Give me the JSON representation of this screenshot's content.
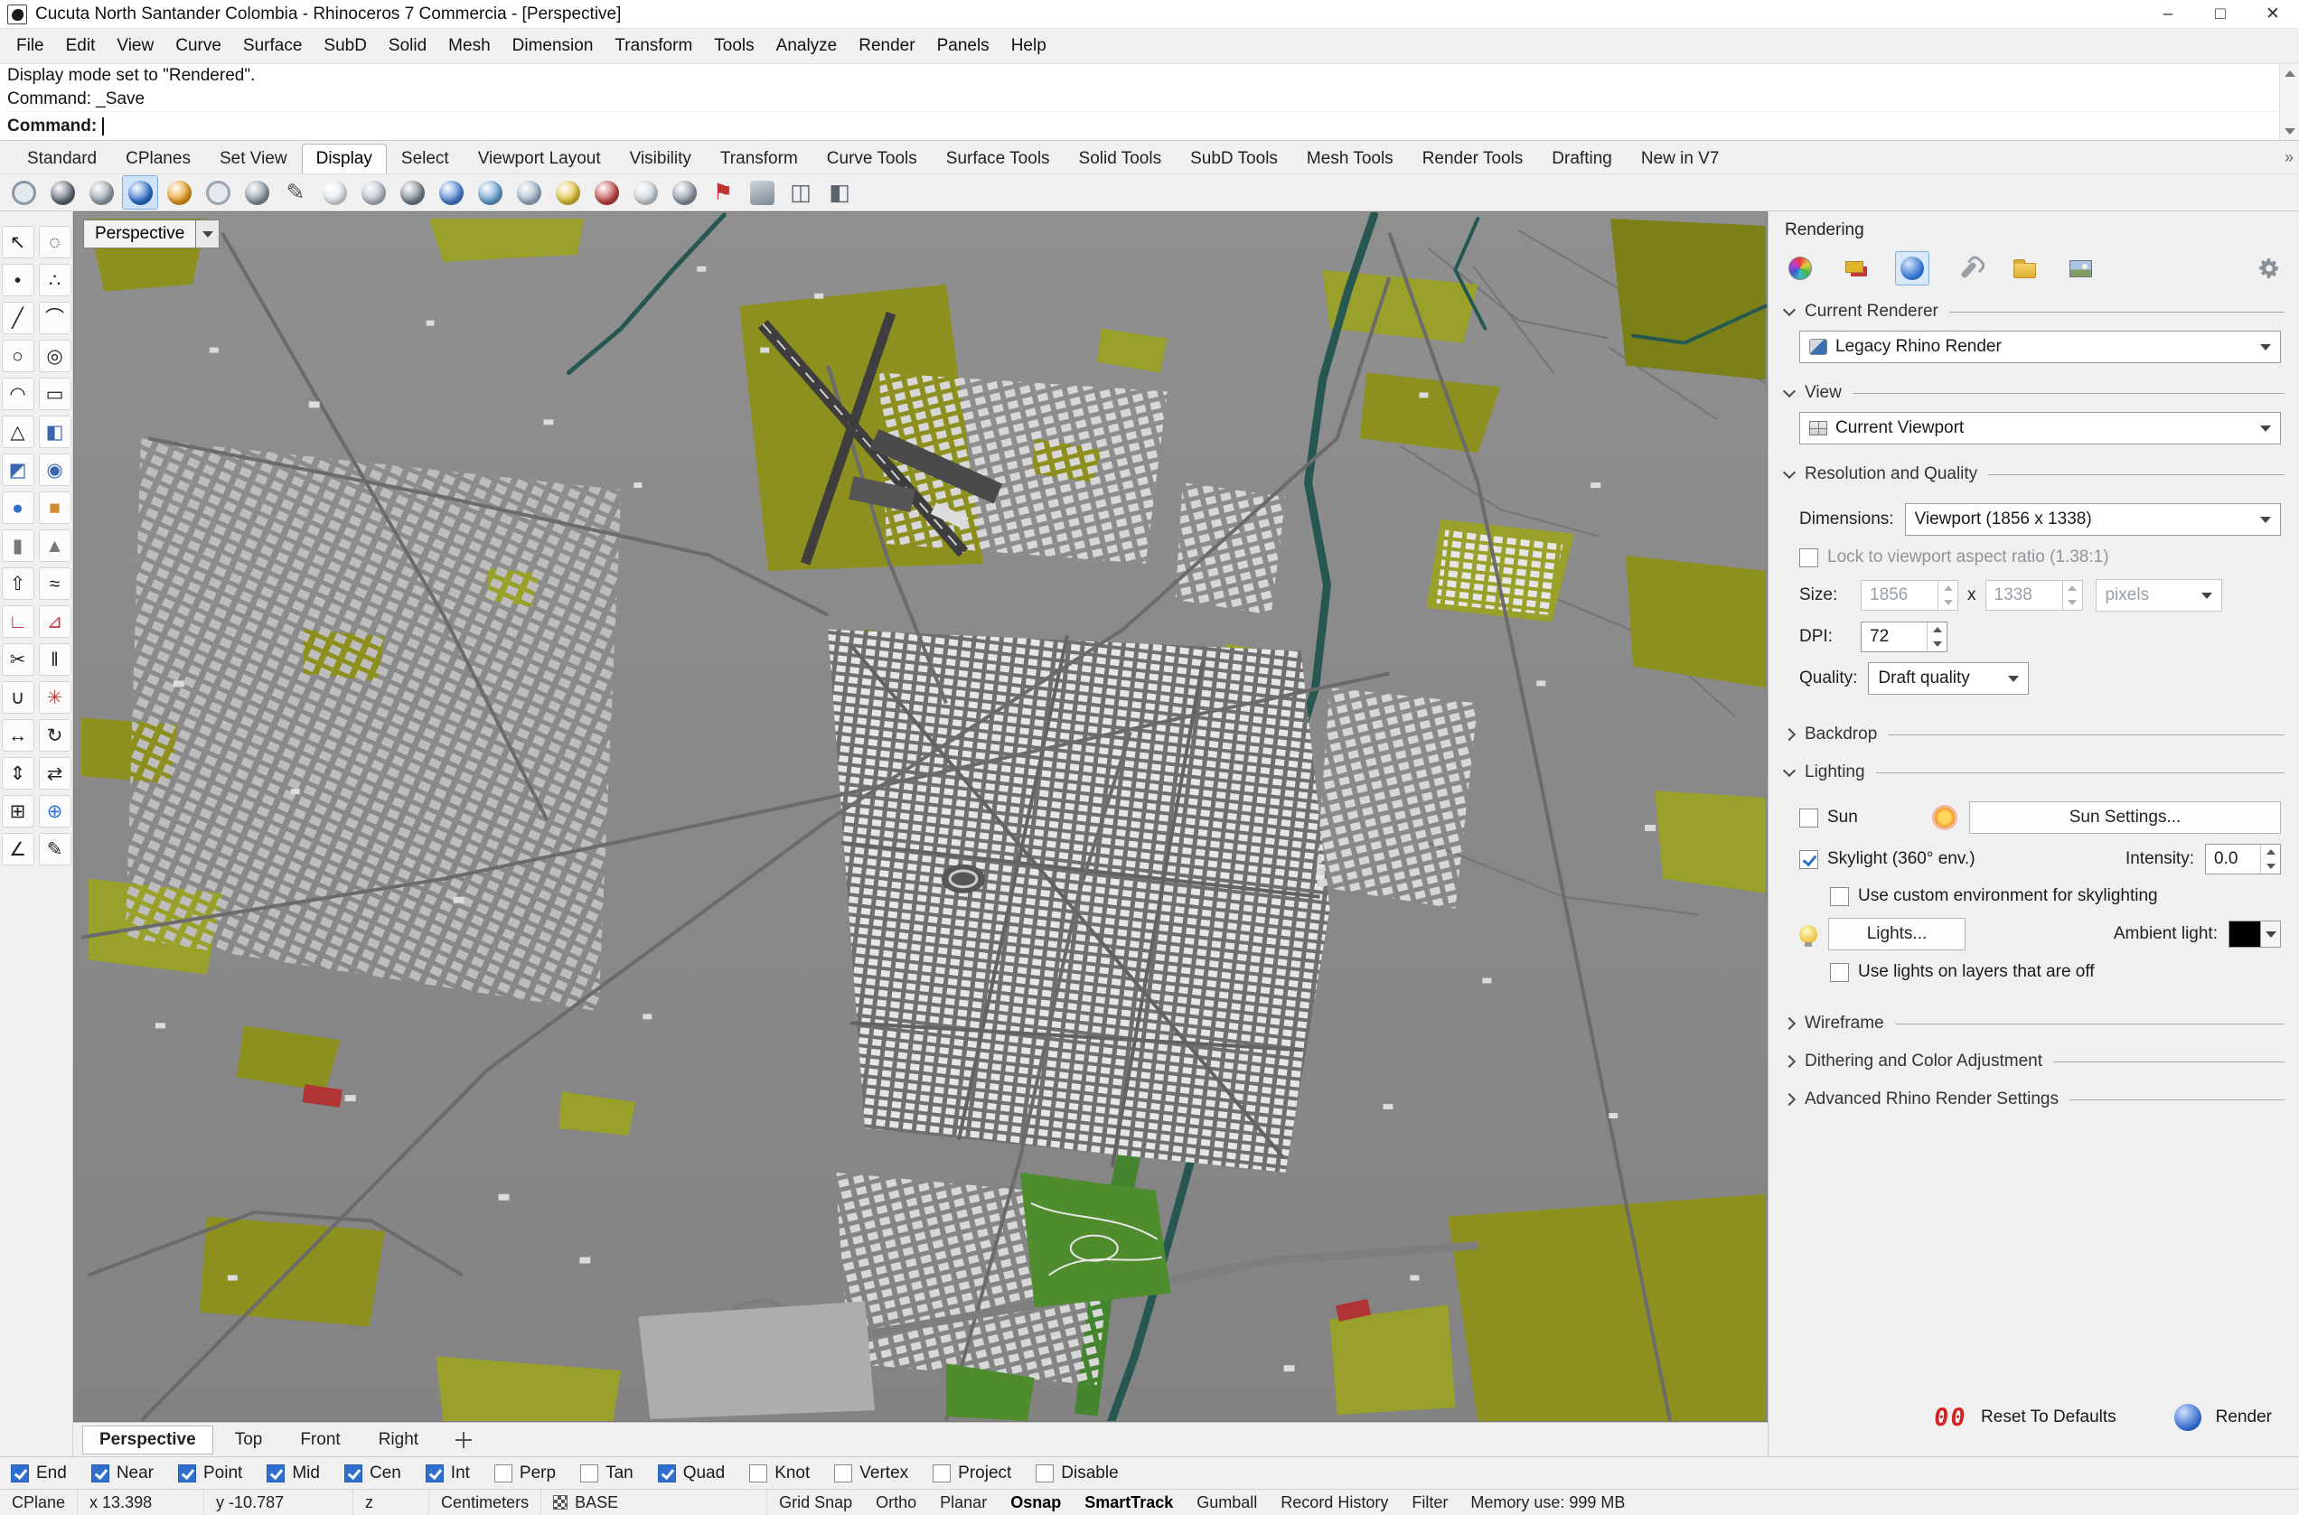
{
  "titlebar": {
    "title": "Cucuta North Santander Colombia - Rhinoceros 7 Commercia - [Perspective]",
    "controls": {
      "minimize": "–",
      "maximize": "□",
      "close": "✕"
    }
  },
  "menubar": {
    "items": [
      "File",
      "Edit",
      "View",
      "Curve",
      "Surface",
      "SubD",
      "Solid",
      "Mesh",
      "Dimension",
      "Transform",
      "Tools",
      "Analyze",
      "Render",
      "Panels",
      "Help"
    ]
  },
  "command_area": {
    "history": [
      "Display mode set to \"Rendered\".",
      "Command: _Save"
    ],
    "prompt": "Command:"
  },
  "toolbar_tabs": {
    "items": [
      {
        "label": "Standard"
      },
      {
        "label": "CPlanes"
      },
      {
        "label": "Set View"
      },
      {
        "label": "Display",
        "active": true
      },
      {
        "label": "Select"
      },
      {
        "label": "Viewport Layout"
      },
      {
        "label": "Visibility"
      },
      {
        "label": "Transform"
      },
      {
        "label": "Curve Tools"
      },
      {
        "label": "Surface Tools"
      },
      {
        "label": "Solid Tools"
      },
      {
        "label": "SubD Tools"
      },
      {
        "label": "Mesh Tools"
      },
      {
        "label": "Render Tools"
      },
      {
        "label": "Drafting"
      },
      {
        "label": "New in V7"
      }
    ]
  },
  "display_toolbar": {
    "items": [
      {
        "name": "wireframe-display-icon",
        "kind": "ring",
        "color": "#8b97a5"
      },
      {
        "name": "shaded-display-icon",
        "color": "#5f6a76"
      },
      {
        "name": "ghosted-display-icon",
        "color": "#97a2ae"
      },
      {
        "name": "rendered-display-icon",
        "color": "#2f6fce",
        "active": true
      },
      {
        "name": "raytraced-display-icon",
        "color": "#e89b1c"
      },
      {
        "name": "technical-display-icon",
        "kind": "ring",
        "color": "#9aa5b0"
      },
      {
        "name": "artistic-display-icon",
        "color": "#8a95a1"
      },
      {
        "name": "pen-display-icon",
        "kind": "glyph",
        "glyph": "✎",
        "color": "#4a5560"
      },
      {
        "name": "arctic-display-icon",
        "color": "#e4ebf1"
      },
      {
        "name": "monochrome-display-icon",
        "color": "#b4bec7"
      },
      {
        "name": "flat-shade-icon",
        "color": "#76818d"
      },
      {
        "name": "shade-selected-icon",
        "color": "#4a7fd4"
      },
      {
        "name": "backface-display-icon",
        "color": "#67a0d1"
      },
      {
        "name": "xray-display-icon",
        "color": "#9fb6cb"
      },
      {
        "name": "emap-display-icon",
        "color": "#e3c23a"
      },
      {
        "name": "curvature-display-icon",
        "color": "#c24444"
      },
      {
        "name": "zebra-display-icon",
        "color": "#cdd5da"
      },
      {
        "name": "draft-angle-display-icon",
        "color": "#8d98a3"
      },
      {
        "name": "red-flag-display-icon",
        "kind": "glyph",
        "glyph": "⚑",
        "color": "#c03232"
      },
      {
        "name": "monitor-display-icon",
        "kind": "rect",
        "color": "#7d8893"
      },
      {
        "name": "stacked-view-icon",
        "kind": "glyph",
        "glyph": "◫",
        "color": "#5a646e"
      },
      {
        "name": "package-view-icon",
        "kind": "glyph",
        "glyph": "◧",
        "color": "#5a646e"
      }
    ]
  },
  "tool_sidebar": {
    "items": [
      {
        "name": "select-tool-icon",
        "glyph": "↖",
        "color": "#222222"
      },
      {
        "name": "lasso-select-tool-icon",
        "glyph": "◌",
        "color": "#222222"
      },
      {
        "name": "point-tool-icon",
        "glyph": "•",
        "color": "#222222"
      },
      {
        "name": "pointcloud-tool-icon",
        "glyph": "∴",
        "color": "#222222"
      },
      {
        "name": "polyline-tool-icon",
        "glyph": "╱",
        "color": "#222222"
      },
      {
        "name": "curve-tool-icon",
        "glyph": "⌒",
        "color": "#222222"
      },
      {
        "name": "circle-tool-icon",
        "glyph": "○",
        "color": "#222222"
      },
      {
        "name": "ellipse-tool-icon",
        "glyph": "◎",
        "color": "#222222"
      },
      {
        "name": "arc-tool-icon",
        "glyph": "◠",
        "color": "#222222"
      },
      {
        "name": "rectangle-tool-icon",
        "glyph": "▭",
        "color": "#222222"
      },
      {
        "name": "polygon-tool-icon",
        "glyph": "△",
        "color": "#222222"
      },
      {
        "name": "surface-tool-icon",
        "glyph": "◧",
        "color": "#3a66b0"
      },
      {
        "name": "sweep-tool-icon",
        "glyph": "◩",
        "color": "#3a66b0"
      },
      {
        "name": "revolve-tool-icon",
        "glyph": "◉",
        "color": "#3a66b0"
      },
      {
        "name": "sphere-tool-icon",
        "glyph": "●",
        "color": "#2f6fce"
      },
      {
        "name": "box-tool-icon",
        "glyph": "■",
        "color": "#d08a2a"
      },
      {
        "name": "cylinder-tool-icon",
        "glyph": "▮",
        "color": "#777777"
      },
      {
        "name": "cone-tool-icon",
        "glyph": "▲",
        "color": "#777777"
      },
      {
        "name": "extrude-tool-icon",
        "glyph": "⇧",
        "color": "#222222"
      },
      {
        "name": "loft-tool-icon",
        "glyph": "≈",
        "color": "#222222"
      },
      {
        "name": "fillet-tool-icon",
        "glyph": "∟",
        "color": "#c23a3a"
      },
      {
        "name": "chamfer-tool-icon",
        "glyph": "⊿",
        "color": "#c23a3a"
      },
      {
        "name": "trim-tool-icon",
        "glyph": "✂",
        "color": "#222222"
      },
      {
        "name": "split-tool-icon",
        "glyph": "‖",
        "color": "#222222"
      },
      {
        "name": "join-tool-icon",
        "glyph": "∪",
        "color": "#222222"
      },
      {
        "name": "explode-tool-icon",
        "glyph": "✳",
        "color": "#c23a3a"
      },
      {
        "name": "move-tool-icon",
        "glyph": "↔",
        "color": "#222222"
      },
      {
        "name": "rotate-tool-icon",
        "glyph": "↻",
        "color": "#222222"
      },
      {
        "name": "scale-tool-icon",
        "glyph": "⇕",
        "color": "#222222"
      },
      {
        "name": "mirror-tool-icon",
        "glyph": "⇄",
        "color": "#222222"
      },
      {
        "name": "array-tool-icon",
        "glyph": "⊞",
        "color": "#222222"
      },
      {
        "name": "gumball-tool-icon",
        "glyph": "⊕",
        "color": "#2f6fce"
      },
      {
        "name": "measure-tool-icon",
        "glyph": "∠",
        "color": "#222222"
      },
      {
        "name": "annotate-tool-icon",
        "glyph": "✎",
        "color": "#222222"
      }
    ]
  },
  "viewport": {
    "label": "Perspective",
    "tabs": [
      {
        "label": "Perspective",
        "active": true
      },
      {
        "label": "Top"
      },
      {
        "label": "Front"
      },
      {
        "label": "Right"
      }
    ]
  },
  "render_panel": {
    "title": "Rendering",
    "tabs": [
      {
        "name": "display-panel-tab",
        "kind": "wheel"
      },
      {
        "name": "layers-panel-tab",
        "kind": "layers"
      },
      {
        "name": "rendering-panel-tab",
        "kind": "render",
        "active": true
      },
      {
        "name": "tools-panel-tab",
        "kind": "wrench"
      },
      {
        "name": "libraries-panel-tab",
        "kind": "folder"
      },
      {
        "name": "textures-panel-tab",
        "kind": "image"
      }
    ],
    "sections": {
      "current_renderer": {
        "header": "Current Renderer",
        "value": "Legacy Rhino Render"
      },
      "view": {
        "header": "View",
        "value": "Current Viewport"
      },
      "resolution": {
        "header": "Resolution and Quality",
        "dimensions_label": "Dimensions:",
        "dimensions_value": "Viewport (1856 x 1338)",
        "lock_label": "Lock to viewport aspect ratio (1.38:1)",
        "size_label": "Size:",
        "width": "1856",
        "multiply": "x",
        "height": "1338",
        "units": "pixels",
        "dpi_label": "DPI:",
        "dpi": "72",
        "quality_label": "Quality:",
        "quality": "Draft quality"
      },
      "backdrop": {
        "header": "Backdrop"
      },
      "lighting": {
        "header": "Lighting",
        "sun_label": "Sun",
        "sun_settings": "Sun Settings...",
        "skylight_label": "Skylight (360° env.)",
        "intensity_label": "Intensity:",
        "intensity": "0.0",
        "custom_env_label": "Use custom environment for skylighting",
        "lights_button": "Lights...",
        "ambient_label": "Ambient light:",
        "ambient_color": "#000000",
        "layers_off_label": "Use lights on layers that are off"
      },
      "wireframe": {
        "header": "Wireframe"
      },
      "dithering": {
        "header": "Dithering and Color Adjustment"
      },
      "advanced": {
        "header": "Advanced Rhino Render Settings"
      }
    },
    "footer": {
      "reset_icon_text": "00",
      "reset": "Reset To Defaults",
      "render": "Render"
    }
  },
  "osnap": {
    "items": [
      {
        "label": "End",
        "checked": true
      },
      {
        "label": "Near",
        "checked": true
      },
      {
        "label": "Point",
        "checked": true
      },
      {
        "label": "Mid",
        "checked": true
      },
      {
        "label": "Cen",
        "checked": true
      },
      {
        "label": "Int",
        "checked": true
      },
      {
        "label": "Perp",
        "checked": false
      },
      {
        "label": "Tan",
        "checked": false
      },
      {
        "label": "Quad",
        "checked": true
      },
      {
        "label": "Knot",
        "checked": false
      },
      {
        "label": "Vertex",
        "checked": false
      },
      {
        "label": "Project",
        "checked": false
      },
      {
        "label": "Disable",
        "checked": false
      }
    ]
  },
  "statusbar": {
    "cplane": "CPlane",
    "x": "x 13.398",
    "y": "y -10.787",
    "z": "z",
    "units": "Centimeters",
    "layer": "BASE",
    "toggles": [
      {
        "label": "Grid Snap"
      },
      {
        "label": "Ortho"
      },
      {
        "label": "Planar"
      },
      {
        "label": "Osnap",
        "active": true
      },
      {
        "label": "SmartTrack",
        "active": true
      },
      {
        "label": "Gumball"
      },
      {
        "label": "Record History"
      },
      {
        "label": "Filter"
      }
    ],
    "memory": "Memory use: 999 MB"
  }
}
